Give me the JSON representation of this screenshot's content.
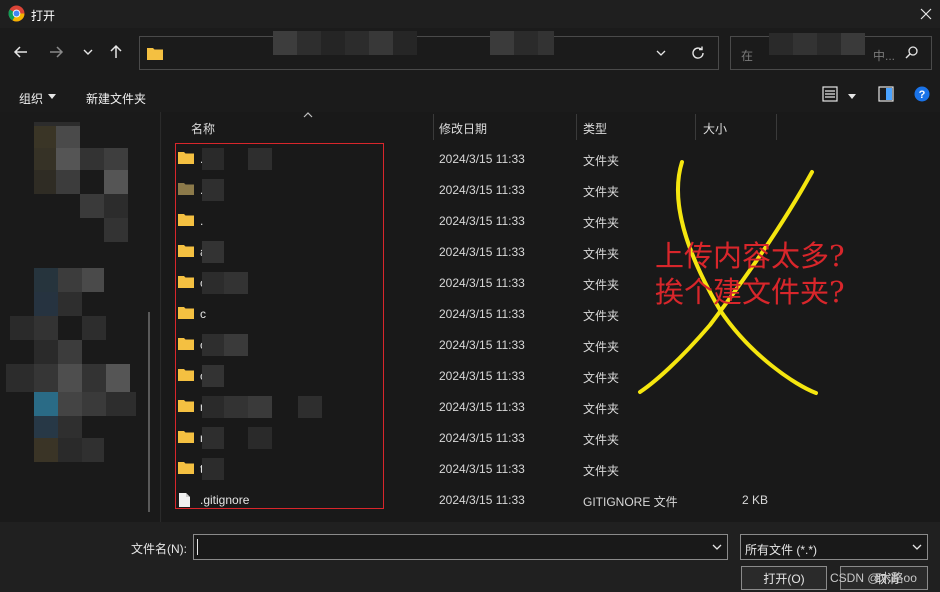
{
  "window": {
    "title": "打开"
  },
  "search": {
    "placeholder_start": "在",
    "placeholder_end": "中..."
  },
  "toolbar": {
    "organize_label": "组织",
    "new_folder_label": "新建文件夹"
  },
  "columns": {
    "name": "名称",
    "date": "修改日期",
    "type": "类型",
    "size": "大小"
  },
  "files": [
    {
      "name": ".",
      "date": "2024/3/15 11:33",
      "type": "文件夹",
      "size": "",
      "icon": "folder-icon"
    },
    {
      "name": ".",
      "date": "2024/3/15 11:33",
      "type": "文件夹",
      "size": "",
      "icon": "folder-icon"
    },
    {
      "name": ".",
      "date": "2024/3/15 11:33",
      "type": "文件夹",
      "size": "",
      "icon": "folder-icon"
    },
    {
      "name": "a",
      "date": "2024/3/15 11:33",
      "type": "文件夹",
      "size": "",
      "icon": "folder-icon"
    },
    {
      "name": "c",
      "date": "2024/3/15 11:33",
      "type": "文件夹",
      "size": "",
      "icon": "folder-icon"
    },
    {
      "name": "c",
      "date": "2024/3/15 11:33",
      "type": "文件夹",
      "size": "",
      "icon": "folder-icon"
    },
    {
      "name": "c",
      "date": "2024/3/15 11:33",
      "type": "文件夹",
      "size": "",
      "icon": "folder-icon"
    },
    {
      "name": "c",
      "date": "2024/3/15 11:33",
      "type": "文件夹",
      "size": "",
      "icon": "folder-icon"
    },
    {
      "name": "n",
      "date": "2024/3/15 11:33",
      "type": "文件夹",
      "size": "",
      "icon": "folder-icon"
    },
    {
      "name": "n",
      "date": "2024/3/15 11:33",
      "type": "文件夹",
      "size": "",
      "icon": "folder-icon"
    },
    {
      "name": "t",
      "date": "2024/3/15 11:33",
      "type": "文件夹",
      "size": "",
      "icon": "folder-icon"
    },
    {
      "name": ".gitignore",
      "date": "2024/3/15 11:33",
      "type": "GITIGNORE 文件",
      "size": "2 KB",
      "icon": "file-icon"
    }
  ],
  "annotation": {
    "line1": "上传内容太多?",
    "line2": "挨个建文件夹?"
  },
  "bottom": {
    "filename_label": "文件名(N):",
    "filename_value": "",
    "filetype_value": "所有文件 (*.*)",
    "open_label": "打开(O)",
    "cancel_label": "取消",
    "watermark": "CSDN @木路oo"
  },
  "colors": {
    "folder": "#f4c041",
    "annotation": "#d8262b",
    "cross": "#f5e60f",
    "highlight_box": "#d8262b"
  }
}
